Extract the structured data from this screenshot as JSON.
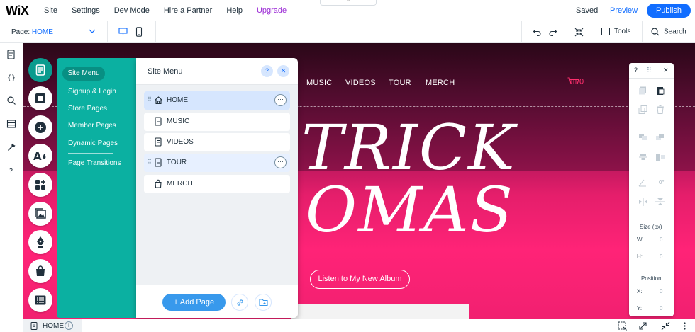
{
  "topbar": {
    "logo": "WiX",
    "menu": [
      "Site",
      "Settings",
      "Dev Mode",
      "Hire a Partner",
      "Help",
      "Upgrade"
    ],
    "collapse_glyph": "⌃",
    "saved": "Saved",
    "preview": "Preview",
    "publish": "Publish"
  },
  "subbar": {
    "page_label": "Page:",
    "page_value": "HOME",
    "tools_label": "Tools",
    "search_label": "Search"
  },
  "canvas": {
    "nav": [
      "MUSIC",
      "VIDEOS",
      "TOUR",
      "MERCH"
    ],
    "cart_count": "0",
    "hero_line1": "TRICK",
    "hero_line2": "OMAS",
    "album_button": "Listen to My New Album"
  },
  "menu_panel": {
    "active_tab": "Site Menu",
    "items": [
      "Signup & Login",
      "Store Pages",
      "Member Pages",
      "Dynamic Pages",
      "Page Transitions"
    ]
  },
  "site_menu": {
    "title": "Site Menu",
    "help": "?",
    "close": "✕",
    "pages": [
      {
        "label": "HOME",
        "icon": "home-icon",
        "state": "selected"
      },
      {
        "label": "MUSIC",
        "icon": "page-icon",
        "state": "normal"
      },
      {
        "label": "VIDEOS",
        "icon": "page-icon",
        "state": "normal"
      },
      {
        "label": "TOUR",
        "icon": "page-icon",
        "state": "hover"
      },
      {
        "label": "MERCH",
        "icon": "shopping-bag-icon",
        "state": "normal"
      }
    ],
    "more_glyph": "···",
    "add_page": "+ Add Page"
  },
  "inspector": {
    "help": "?",
    "close": "✕",
    "angle_value": "0°",
    "size_label": "Size (px)",
    "w_label": "W:",
    "h_label": "H:",
    "w_value": "0",
    "h_value": "0",
    "position_label": "Position",
    "x_label": "X:",
    "y_label": "Y:",
    "x_value": "0",
    "y_value": "0"
  },
  "bottombar": {
    "page": "HOME",
    "info": "i"
  },
  "colors": {
    "accent": "#116dff",
    "teal": "#0bb0a1",
    "upgrade": "#9a27d5",
    "hero_pink": "#ff2377"
  }
}
